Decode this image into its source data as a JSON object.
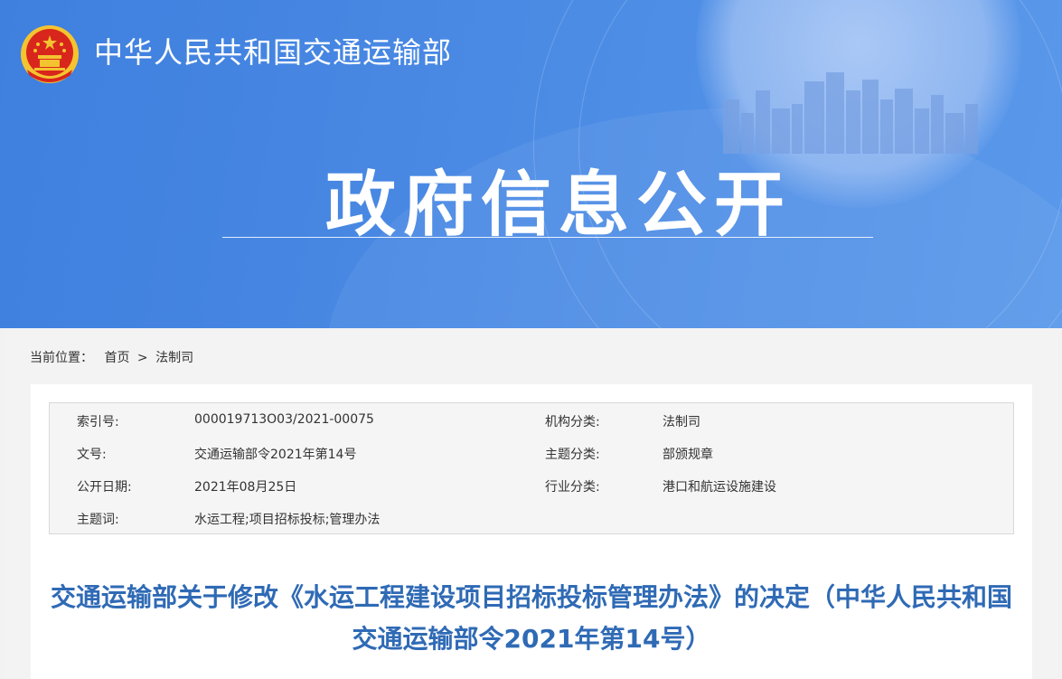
{
  "header": {
    "site_title": "中华人民共和国交通运输部",
    "banner_title": "政府信息公开",
    "emblem_icon": "national-emblem-icon"
  },
  "breadcrumb": {
    "label": "当前位置：",
    "items": [
      "首页",
      "法制司"
    ],
    "separator": ">"
  },
  "meta": {
    "rows": [
      {
        "k1": "索引号:",
        "v1": "000019713O03/2021-00075",
        "k2": "机构分类:",
        "v2": "法制司"
      },
      {
        "k1": "文号:",
        "v1": "交通运输部令2021年第14号",
        "k2": "主题分类:",
        "v2": "部颁规章"
      },
      {
        "k1": "公开日期:",
        "v1": "2021年08月25日",
        "k2": "行业分类:",
        "v2": "港口和航运设施建设"
      },
      {
        "k1": "主题词:",
        "v1": "水运工程;项目招标投标;管理办法",
        "k2": "",
        "v2": ""
      }
    ]
  },
  "document": {
    "title": "交通运输部关于修改《水运工程建设项目招标投标管理办法》的决定（中华人民共和国交通运输部令2021年第14号）"
  },
  "colors": {
    "banner": "#4a8ae4",
    "title_blue": "#2f6ab5",
    "emblem_red": "#d8261c",
    "emblem_gold": "#f4c430"
  }
}
